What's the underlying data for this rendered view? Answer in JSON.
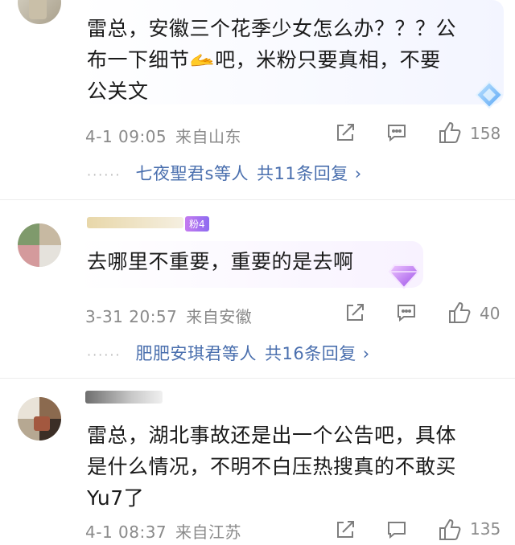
{
  "comments": [
    {
      "text_lines": [
        "雷总，安徽三个花季少女怎么办？？？公",
        "布一下细节🫴吧，米粉只要真相，不要",
        "公关文"
      ],
      "time": "4-1 09:05",
      "location": "来自山东",
      "likes": "158",
      "reply_users": "七夜聖君s等人",
      "reply_count": "共11条回复",
      "reply_chevron": "›"
    },
    {
      "badge": "粉4",
      "text_lines": [
        "去哪里不重要，重要的是去啊"
      ],
      "time": "3-31 20:57",
      "location": "来自安徽",
      "likes": "40",
      "reply_users": "肥肥安琪君等人",
      "reply_count": "共16条回复",
      "reply_chevron": "›"
    },
    {
      "text_lines": [
        "雷总，湖北事故还是出一个公告吧，具体",
        "是什么情况，不明不白压热搜真的不敢买",
        "Yu7了"
      ],
      "time": "4-1 08:37",
      "location": "来自江苏",
      "likes": "135"
    }
  ],
  "icons": {
    "repost": "share-square-icon",
    "comment": "comment-bubble-icon",
    "like": "thumbs-up-icon",
    "gem": "diamond-icon"
  }
}
